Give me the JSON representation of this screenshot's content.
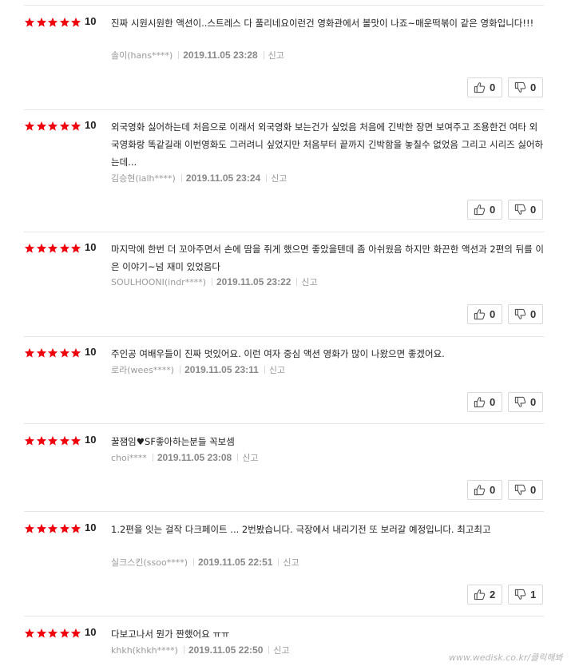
{
  "max_score": 5,
  "reviews": [
    {
      "rating": 5,
      "score": "10",
      "text": "진짜 시원시원한 액션이..스트레스 다 풀리네요이런건 영화관에서 볼맛이 나죠~매운떡볶이 같은 영화입니다!!!",
      "author": "솔이(hans****)",
      "date": "2019.11.05 23:28",
      "report": "신고",
      "likes": "0",
      "dislikes": "0"
    },
    {
      "rating": 5,
      "score": "10",
      "text": "외국영화 싫어하는데 처음으로 이래서 외국영화 보는건가 싶었음 처음에 긴박한 장면 보여주고 조용한건 여타 외국영화랑 똑같길래 이번영화도 그러려니 싶었지만 처음부터 끝까지 긴박함을 놓칠수 없었음 그리고 시리즈 싫어하는데...",
      "author": "김승현(ialh****)",
      "date": "2019.11.05 23:24",
      "report": "신고",
      "likes": "0",
      "dislikes": "0"
    },
    {
      "rating": 5,
      "score": "10",
      "text": "마지막에 한번 더 꼬아주면서 손에 땀을 쥐게 했으면 좋았을텐데 좀 아쉬웠음 하지만 화끈한 액션과 2편의 뒤를 이은 이야기~넘 재미 있었음다",
      "author": "SOULHOONI(indr****)",
      "date": "2019.11.05 23:22",
      "report": "신고",
      "likes": "0",
      "dislikes": "0"
    },
    {
      "rating": 5,
      "score": "10",
      "text": "주인공 여배우들이 진짜 멋있어요. 이런 여자 중심 액션 영화가 많이 나왔으면 좋겠어요.",
      "author": "로라(wees****)",
      "date": "2019.11.05 23:11",
      "report": "신고",
      "likes": "0",
      "dislikes": "0"
    },
    {
      "rating": 5,
      "score": "10",
      "text": "꿀잼임♥SF좋아하는분들 꼭보셈",
      "author": "choi****",
      "date": "2019.11.05 23:08",
      "report": "신고",
      "likes": "0",
      "dislikes": "0"
    },
    {
      "rating": 5,
      "score": "10",
      "text": "1.2편을 잇는 걸작 다크페이트 ... 2번봤습니다. 극장에서 내리기전 또 보러갈 예정입니다. 최고최고",
      "author": "실크스킨(ssoo****)",
      "date": "2019.11.05 22:51",
      "report": "신고",
      "likes": "2",
      "dislikes": "1"
    },
    {
      "rating": 5,
      "score": "10",
      "text": "다보고나서 뭔가 짠했어요 ㅠㅠ",
      "author": "khkh(khkh****)",
      "date": "2019.11.05 22:50",
      "report": "신고"
    }
  ],
  "watermark": "www.wedisk.co.kr/클릭해봐",
  "colors": {
    "star": "#f0000d",
    "text": "#222222",
    "meta": "#999999",
    "border": "#d8d8d8"
  },
  "icons": {
    "like": "thumbs-up-icon",
    "dislike": "thumbs-down-icon",
    "rating": "star-icon"
  }
}
